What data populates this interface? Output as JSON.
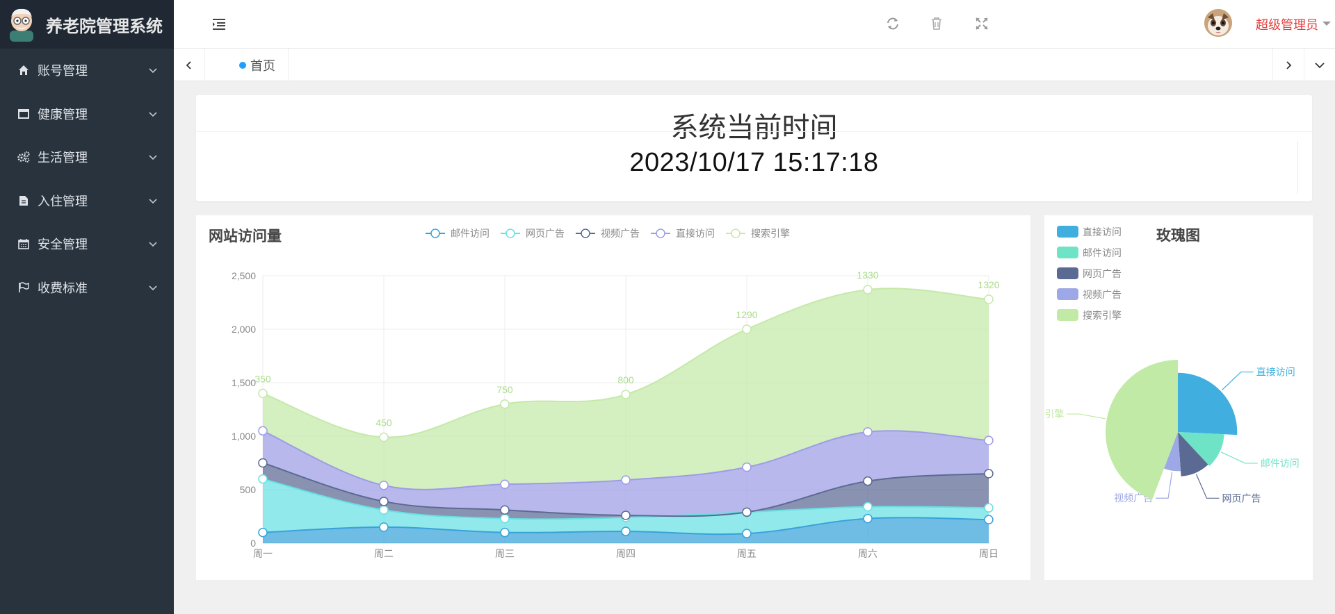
{
  "app": {
    "title": "养老院管理系统"
  },
  "sidebar": {
    "items": [
      {
        "label": "账号管理",
        "icon": "home-icon"
      },
      {
        "label": "健康管理",
        "icon": "window-icon"
      },
      {
        "label": "生活管理",
        "icon": "gears-icon"
      },
      {
        "label": "入住管理",
        "icon": "document-icon"
      },
      {
        "label": "安全管理",
        "icon": "calendar-icon"
      },
      {
        "label": "收费标准",
        "icon": "flag-icon"
      }
    ]
  },
  "header": {
    "user_name": "超级管理员",
    "icons": [
      "menu-toggle-icon",
      "refresh-icon",
      "trash-icon",
      "fullscreen-icon",
      "avatar"
    ]
  },
  "tabs": {
    "home_label": "首页"
  },
  "time_card": {
    "title": "系统当前时间",
    "value": "2023/10/17 15:17:18"
  },
  "colors": {
    "sidebar_bg": "#28333e",
    "brand_bg": "#1f2833",
    "accent": "#1e9fff",
    "user_name": "#e53e3e",
    "mail": "#37a2da",
    "ad": "#67e0e3",
    "video": "#5b6a93",
    "direct": "#9d9ce6",
    "search": "#c4e9a8"
  },
  "chart_data": [
    {
      "type": "area",
      "title": "网站访问量",
      "stacked": true,
      "smooth": true,
      "categories": [
        "周一",
        "周二",
        "周三",
        "周四",
        "周五",
        "周六",
        "周日"
      ],
      "ylim": [
        0,
        2500
      ],
      "yticks": [
        "0",
        "500",
        "1,000",
        "1,500",
        "2,000",
        "2,500"
      ],
      "legend_position": "top",
      "series": [
        {
          "name": "邮件访问",
          "color": "#37a2da",
          "values": [
            100,
            150,
            100,
            110,
            90,
            230,
            220
          ]
        },
        {
          "name": "网页广告",
          "color": "#67e0e3",
          "values": [
            500,
            160,
            130,
            130,
            200,
            110,
            110
          ]
        },
        {
          "name": "视频广告",
          "color": "#5b6a93",
          "values": [
            150,
            80,
            80,
            20,
            0,
            240,
            320
          ]
        },
        {
          "name": "直接访问",
          "color": "#9d9ce6",
          "values": [
            300,
            150,
            240,
            330,
            420,
            460,
            310
          ]
        },
        {
          "name": "搜索引擎",
          "color": "#c4e9a8",
          "values": [
            350,
            450,
            750,
            800,
            1290,
            1330,
            1320
          ]
        }
      ],
      "labeled_series": "搜索引擎",
      "data_labels": [
        "350",
        "450",
        "750",
        "800",
        "1290",
        "1330",
        "1320"
      ]
    },
    {
      "type": "pie",
      "variant": "rose",
      "title": "玫瑰图",
      "legend_position": "top-left",
      "slices": [
        {
          "name": "直接访问",
          "value": 335,
          "color": "#40afe0"
        },
        {
          "name": "邮件访问",
          "value": 160,
          "color": "#6ee3c6"
        },
        {
          "name": "网页广告",
          "value": 140,
          "color": "#5b6a93"
        },
        {
          "name": "视频广告",
          "value": 90,
          "color": "#9da8e6"
        },
        {
          "name": "搜索引擎",
          "value": 575,
          "color": "#c1eaa6"
        }
      ],
      "outer_labels": [
        "直接访问",
        "邮件访问",
        "网页广告",
        "视频广告",
        "搜索引擎"
      ]
    }
  ]
}
